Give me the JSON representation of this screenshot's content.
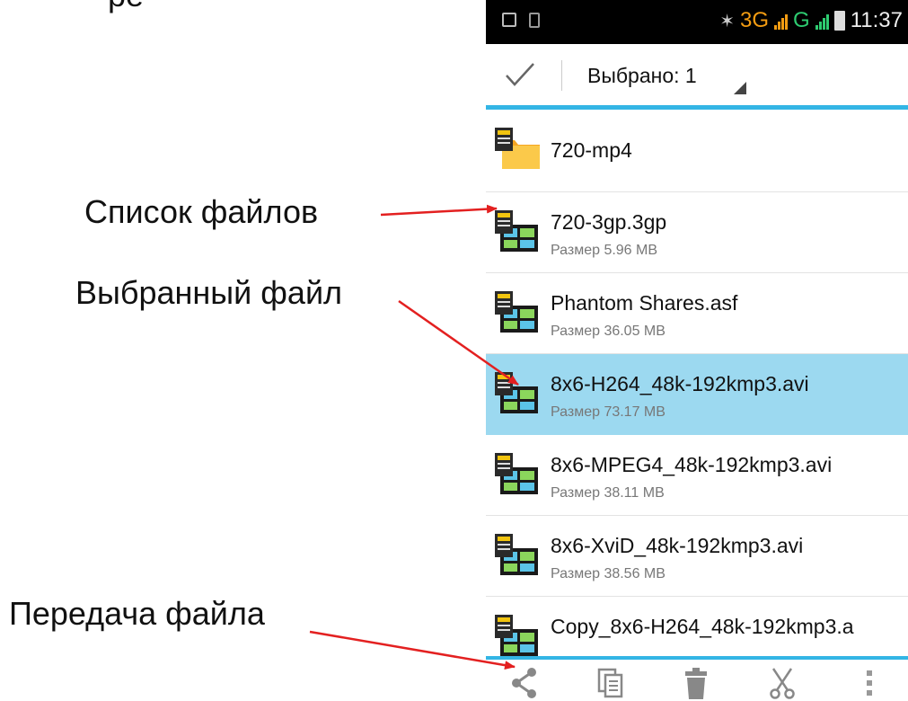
{
  "annotations": {
    "top_partial": "ре",
    "file_list": "Список файлов",
    "selected_file": "Выбранный файл",
    "transfer_file": "Передача файла"
  },
  "status_bar": {
    "network": "3G",
    "network2": "G",
    "time": "11:37"
  },
  "action_bar": {
    "title": "Выбрано: 1"
  },
  "files": [
    {
      "name": "720-mp4",
      "size": "",
      "type": "folder",
      "selected": false
    },
    {
      "name": "720-3gp.3gp",
      "size": "Размер 5.96 MB",
      "type": "video",
      "selected": false
    },
    {
      "name": "Phantom Shares.asf",
      "size": "Размер 36.05 MB",
      "type": "video",
      "selected": false
    },
    {
      "name": "8x6-H264_48k-192kmp3.avi",
      "size": "Размер 73.17 MB",
      "type": "video",
      "selected": true
    },
    {
      "name": "8x6-MPEG4_48k-192kmp3.avi",
      "size": "Размер 38.11 MB",
      "type": "video",
      "selected": false
    },
    {
      "name": "8x6-XviD_48k-192kmp3.avi",
      "size": "Размер 38.56 MB",
      "type": "video",
      "selected": false
    },
    {
      "name": "Copy_8x6-H264_48k-192kmp3.a",
      "size": "",
      "type": "video",
      "selected": false
    }
  ],
  "bottom_bar": {
    "icons": [
      "share-icon",
      "copy-icon",
      "delete-icon",
      "cut-icon",
      "overflow-menu-icon"
    ]
  },
  "colors": {
    "accent": "#33b5e5",
    "selected_row": "#9cd9f0",
    "arrow": "#e32020",
    "status_orange": "#f39c12",
    "status_green": "#2ecc71"
  }
}
